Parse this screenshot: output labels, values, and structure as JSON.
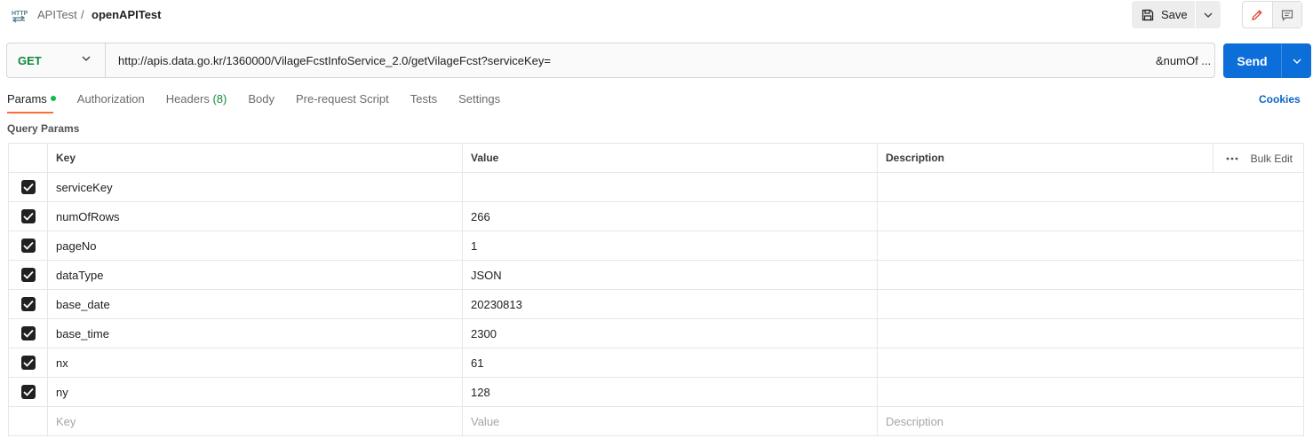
{
  "header": {
    "icon": "http-icon",
    "breadcrumb_parent": "APITest",
    "breadcrumb_separator": "/",
    "breadcrumb_current": "openAPITest",
    "save_label": "Save"
  },
  "request": {
    "method": "GET",
    "url": "http://apis.data.go.kr/1360000/VilageFcstInfoService_2.0/getVilageFcst?serviceKey=",
    "url_tail": "&numOf ...",
    "send_label": "Send"
  },
  "tabs": {
    "params": "Params",
    "authorization": "Authorization",
    "headers": "Headers",
    "headers_count": "(8)",
    "body": "Body",
    "pre_request": "Pre-request Script",
    "tests": "Tests",
    "settings": "Settings",
    "cookies": "Cookies"
  },
  "query_params": {
    "title": "Query Params",
    "columns": {
      "key": "Key",
      "value": "Value",
      "description": "Description",
      "bulk_edit": "Bulk Edit"
    },
    "rows": [
      {
        "key": "serviceKey",
        "value": "",
        "description": ""
      },
      {
        "key": "numOfRows",
        "value": "266",
        "description": ""
      },
      {
        "key": "pageNo",
        "value": "1",
        "description": ""
      },
      {
        "key": "dataType",
        "value": "JSON",
        "description": ""
      },
      {
        "key": "base_date",
        "value": "20230813",
        "description": ""
      },
      {
        "key": "base_time",
        "value": "2300",
        "description": ""
      },
      {
        "key": "nx",
        "value": "61",
        "description": ""
      },
      {
        "key": "ny",
        "value": "128",
        "description": ""
      }
    ],
    "placeholders": {
      "key": "Key",
      "value": "Value",
      "description": "Description"
    }
  },
  "colors": {
    "method": "#0f8a3c",
    "send": "#0c6ed9",
    "active_tab_underline": "#ff6c37",
    "params_dot": "#0cbb52",
    "cookies_link": "#0b65c2"
  }
}
